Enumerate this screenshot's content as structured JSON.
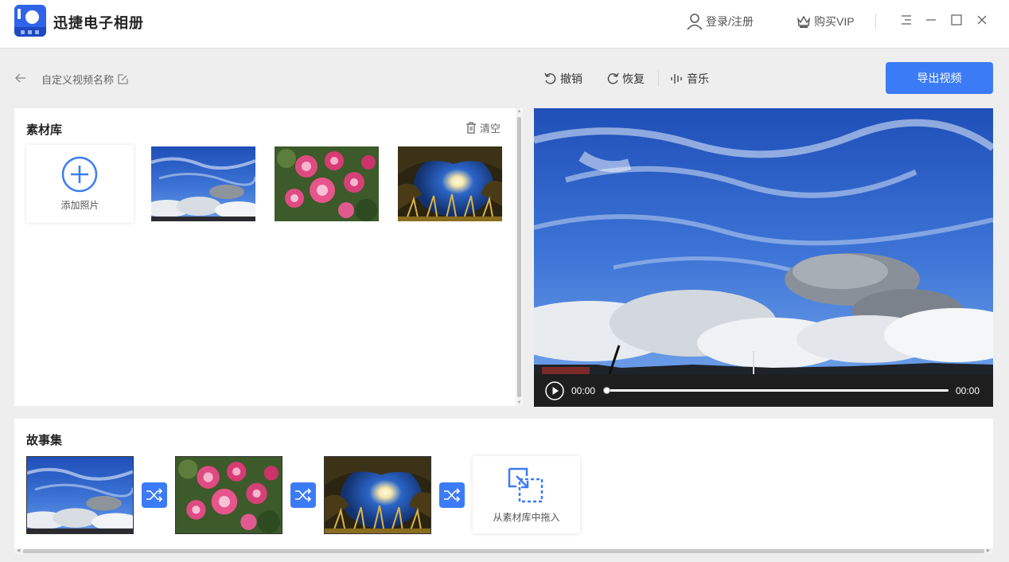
{
  "titlebar": {
    "app_title": "迅捷电子相册",
    "login_label": "登录/注册",
    "vip_label": "购买VIP"
  },
  "toolbar": {
    "video_name": "自定义视频名称",
    "undo_label": "撤销",
    "redo_label": "恢复",
    "music_label": "音乐",
    "export_label": "导出视频"
  },
  "library": {
    "title": "素材库",
    "clear_label": "清空",
    "add_label": "添加照片",
    "items": [
      {
        "icon": "sky-clouds-photo"
      },
      {
        "icon": "pink-roses-photo"
      },
      {
        "icon": "night-lamp-photo"
      }
    ]
  },
  "preview": {
    "current_time": "00:00",
    "total_time": "00:00",
    "progress": 0
  },
  "story": {
    "title": "故事集",
    "drop_label": "从素材库中拖入"
  },
  "colors": {
    "accent": "#3c7bf6",
    "logo": "#2f64e8"
  }
}
